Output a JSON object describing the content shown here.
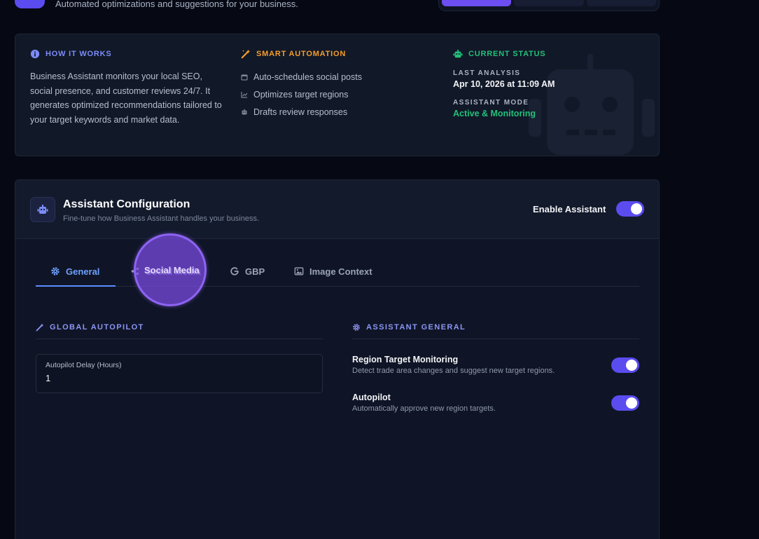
{
  "header": {
    "subtitle": "Automated optimizations and suggestions for your business."
  },
  "info": {
    "how_it_works": {
      "title": "HOW IT WORKS",
      "text": "Business Assistant monitors your local SEO, social presence, and customer reviews 24/7. It generates optimized recommendations tailored to your target keywords and market data."
    },
    "smart_automation": {
      "title": "SMART AUTOMATION",
      "items": [
        {
          "label": "Auto-schedules social posts",
          "icon": "calendar-icon"
        },
        {
          "label": "Optimizes target regions",
          "icon": "chart-icon"
        },
        {
          "label": "Drafts review responses",
          "icon": "robot-icon"
        }
      ]
    },
    "current_status": {
      "title": "CURRENT STATUS",
      "last_analysis_label": "LAST ANALYSIS",
      "last_analysis_value": "Apr 10, 2026 at 11:09 AM",
      "mode_label": "ASSISTANT MODE",
      "mode_value": "Active & Monitoring"
    }
  },
  "config": {
    "title": "Assistant Configuration",
    "subtitle": "Fine-tune how Business Assistant handles your business.",
    "enable_label": "Enable Assistant",
    "enable_on": true,
    "tabs": [
      {
        "label": "General",
        "icon": "gear-icon",
        "active": true
      },
      {
        "label": "Social Media",
        "icon": "share-icon",
        "active": false
      },
      {
        "label": "GBP",
        "icon": "google-icon",
        "active": false
      },
      {
        "label": "Image Context",
        "icon": "image-icon",
        "active": false
      }
    ],
    "global_autopilot": {
      "title": "GLOBAL AUTOPILOT",
      "delay_label": "Autopilot Delay (Hours)",
      "delay_value": "1"
    },
    "assistant_general": {
      "title": "ASSISTANT GENERAL",
      "settings": [
        {
          "title": "Region Target Monitoring",
          "desc": "Detect trade area changes and suggest new target regions.",
          "on": true
        },
        {
          "title": "Autopilot",
          "desc": "Automatically approve new region targets.",
          "on": true
        }
      ]
    }
  },
  "colors": {
    "accent": "#5b4cf0",
    "tab_active": "#6ea0ff",
    "status_green": "#22c07a",
    "automation_orange": "#f59e2b"
  }
}
